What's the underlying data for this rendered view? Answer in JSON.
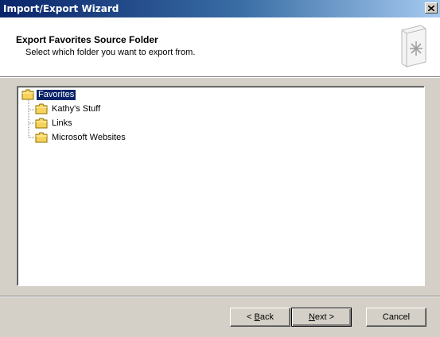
{
  "window": {
    "title": "Import/Export Wizard"
  },
  "header": {
    "title": "Export Favorites Source Folder",
    "subtitle": "Select which folder you want to export from."
  },
  "tree": {
    "root": "Favorites",
    "children": [
      "Kathy's Stuff",
      "Links",
      "Microsoft Websites"
    ]
  },
  "buttons": {
    "back": {
      "pre": "< ",
      "key": "B",
      "post": "ack"
    },
    "next": {
      "key": "N",
      "post": "ext >"
    },
    "cancel": "Cancel"
  },
  "colors": {
    "title_gradient_start": "#0a246a",
    "selection": "#0a246a",
    "face": "#d4d0c8"
  },
  "icons": [
    "close-icon",
    "favorites-book-icon",
    "folder-icon"
  ]
}
